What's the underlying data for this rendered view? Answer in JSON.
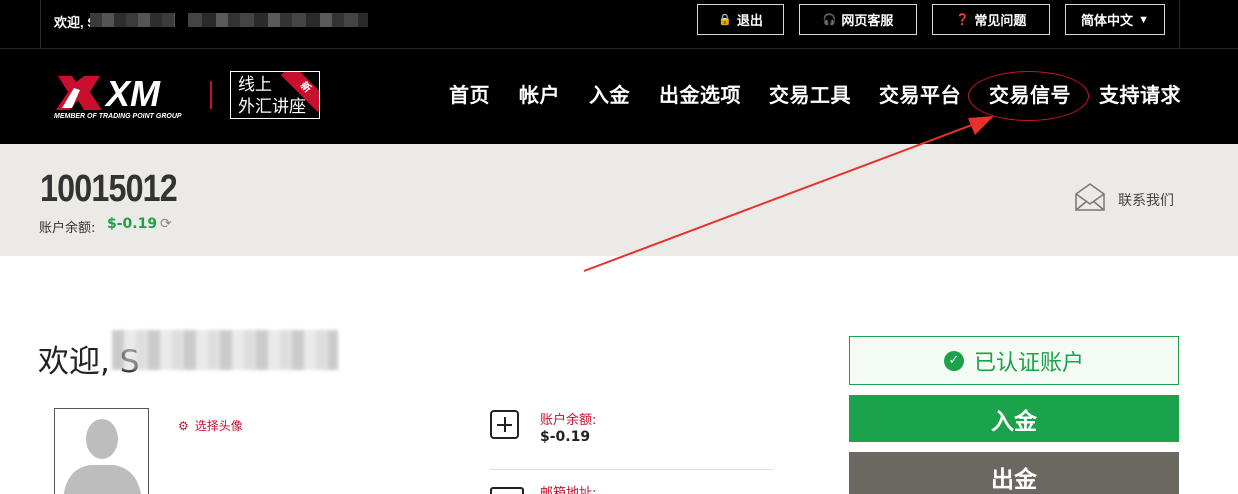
{
  "topbar": {
    "welcome": "欢迎, S",
    "logout": "退出",
    "support": "网页客服",
    "faq": "常见问题",
    "language": "简体中文"
  },
  "logo": {
    "text": "XM",
    "tagline": "MEMBER OF TRADING POINT GROUP"
  },
  "promo": {
    "line1": "线上",
    "line2": "外汇讲座",
    "badge": "新"
  },
  "nav": {
    "items": [
      "首页",
      "帐户",
      "入金",
      "出金选项",
      "交易工具",
      "交易平台",
      "交易信号",
      "支持请求"
    ]
  },
  "account": {
    "number": "10015012",
    "balance_label": "账户余额:",
    "balance_value": "$-0.19",
    "contact": "联系我们"
  },
  "main": {
    "welcome": "欢迎, S",
    "choose_avatar": "选择头像",
    "balance_label": "账户余额:",
    "balance_value": "$-0.19",
    "email_label": "邮箱地址:",
    "verified": "已认证账户",
    "deposit": "入金",
    "withdraw": "出金"
  },
  "colors": {
    "brand_red": "#c8102e",
    "green": "#1aa34a",
    "gray_button": "#6b6862",
    "strip_bg": "#ebeae7"
  }
}
